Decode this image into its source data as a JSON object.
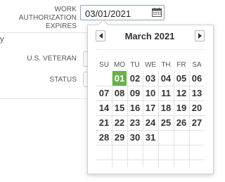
{
  "form": {
    "work_auth_label_line1": "WORK AUTHORIZATION",
    "work_auth_label_line2": "EXPIRES",
    "work_auth_value": "03/01/2021",
    "section_fragment": "y",
    "veteran_label": "U.S. VETERAN",
    "status_label": "STATUS"
  },
  "calendar_icon": "calendar-icon",
  "datepicker": {
    "title": "March 2021",
    "prev_icon": "chevron-left-icon",
    "next_icon": "chevron-right-icon",
    "weekdays": [
      "SU",
      "MO",
      "TU",
      "WE",
      "TH",
      "FR",
      "SA"
    ],
    "weeks": [
      [
        "",
        "01",
        "02",
        "03",
        "04",
        "05",
        "06"
      ],
      [
        "07",
        "08",
        "09",
        "10",
        "11",
        "12",
        "13"
      ],
      [
        "14",
        "15",
        "16",
        "17",
        "18",
        "19",
        "20"
      ],
      [
        "21",
        "22",
        "23",
        "24",
        "25",
        "26",
        "27"
      ],
      [
        "28",
        "29",
        "30",
        "31",
        "",
        "",
        ""
      ]
    ],
    "selected_day": "01",
    "selected_color": "#6ab04c"
  }
}
